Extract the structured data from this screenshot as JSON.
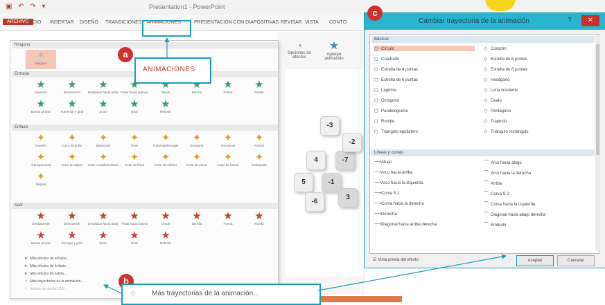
{
  "window": {
    "title": "Presentation1 - PowerPoint",
    "quick_access": "▣ ↶ ↷ ▾",
    "tabs": [
      "ARCHIVO",
      "INICIO",
      "INSERTAR",
      "DISEÑO",
      "TRANSICIONES",
      "ANIMACIONES",
      "PRESENTACIÓN CON DIAPOSITIVAS",
      "REVISAR",
      "VISTA",
      "CONTO"
    ]
  },
  "gallery": {
    "sections": [
      "Ninguno",
      "Entrada",
      "Énfasis",
      "Salir"
    ],
    "none_item": "Ninguno",
    "entrance": [
      "Aparecer",
      "Desvanecer",
      "Desplazar hacia arriba",
      "Flotar hacia adentro",
      "Dividir",
      "Barrido",
      "Forma",
      "Rueda",
      "Barras al azar",
      "Aumentar y girar",
      "Zoom",
      "Girar",
      "Rebotar"
    ],
    "emphasis": [
      "Impulso",
      "Color de pulso",
      "Balancear",
      "Girar",
      "Aumentar/Encoger",
      "Desaturar",
      "Oscurecer",
      "Aclarar",
      "Transparencia",
      "Color de objeto",
      "Color complementario",
      "Color de línea",
      "Color de relleno",
      "Color de pincel",
      "Color de fuente",
      "Subrayado",
      "Negrita"
    ],
    "exit": [
      "Desaparecer",
      "Desvanecer",
      "Desplazar hacia abajo",
      "Flotar hacia afuera",
      "Dividir",
      "Barrido",
      "Forma",
      "Rueda",
      "Barras al azar",
      "Encoger y girar",
      "Zoom",
      "Girar",
      "Rebotar"
    ],
    "more": [
      "Más efectos de entrada...",
      "Más efectos de énfasis...",
      "Más efectos de salida...",
      "Más trayectorias de la animación...",
      "Verbos de acción OLE..."
    ]
  },
  "toolbar": {
    "icons": [
      "Opciones de efectos",
      "Agregar animación"
    ]
  },
  "dice": [
    "-3",
    "-7",
    "4",
    "-2",
    "-1",
    "5",
    "-6",
    "3"
  ],
  "dialog": {
    "title": "Cambiar trayectoria de la animación",
    "help": "?",
    "close": "✕",
    "section_basic": "Básicos",
    "basic_left": [
      "Círculo",
      "Cuadrado",
      "Estrella de 4 puntas",
      "Estrella de 6 puntas",
      "Lágrima",
      "Octógono",
      "Paralelogramo",
      "Rombo",
      "Triángulo equilátero"
    ],
    "basic_right": [
      "Corazón",
      "Estrella de 5 puntas",
      "Estrella de 8 puntas",
      "Hexágono",
      "Luna creciente",
      "Óvalo",
      "Pentágono",
      "Trapecio",
      "Triángulo rectángulo"
    ],
    "section_lines": "Líneas y curvas",
    "lines_left": [
      "Abajo",
      "Arco hacia arriba",
      "Arco hacia la izquierda",
      "Curva S 1",
      "Curva hacia la derecha",
      "Derecha",
      "Diagonal hacia arriba derecha"
    ],
    "lines_right": [
      "Arco hacia abajo",
      "Arco hacia la derecha",
      "Arriba",
      "Curva S 2",
      "Curva hacia la izquierda",
      "Diagonal hacia abajo derecha",
      "Embudo"
    ],
    "preview_label": "Vista previa del efecto",
    "ok_label": "Aceptar",
    "cancel_label": "Cancelar"
  },
  "callouts": {
    "a_badge": "a",
    "a_text": "ANIMACIONES",
    "b_badge": "b",
    "b_text": "Más trayectorias de la animación...",
    "c_badge": "c"
  },
  "colors": {
    "accent": "#16a0b7",
    "badge": "#d0312d",
    "entrance": "#3a9a6b",
    "emphasis": "#e0a020",
    "exit": "#c8402e",
    "selection": "#f6c9b6"
  }
}
